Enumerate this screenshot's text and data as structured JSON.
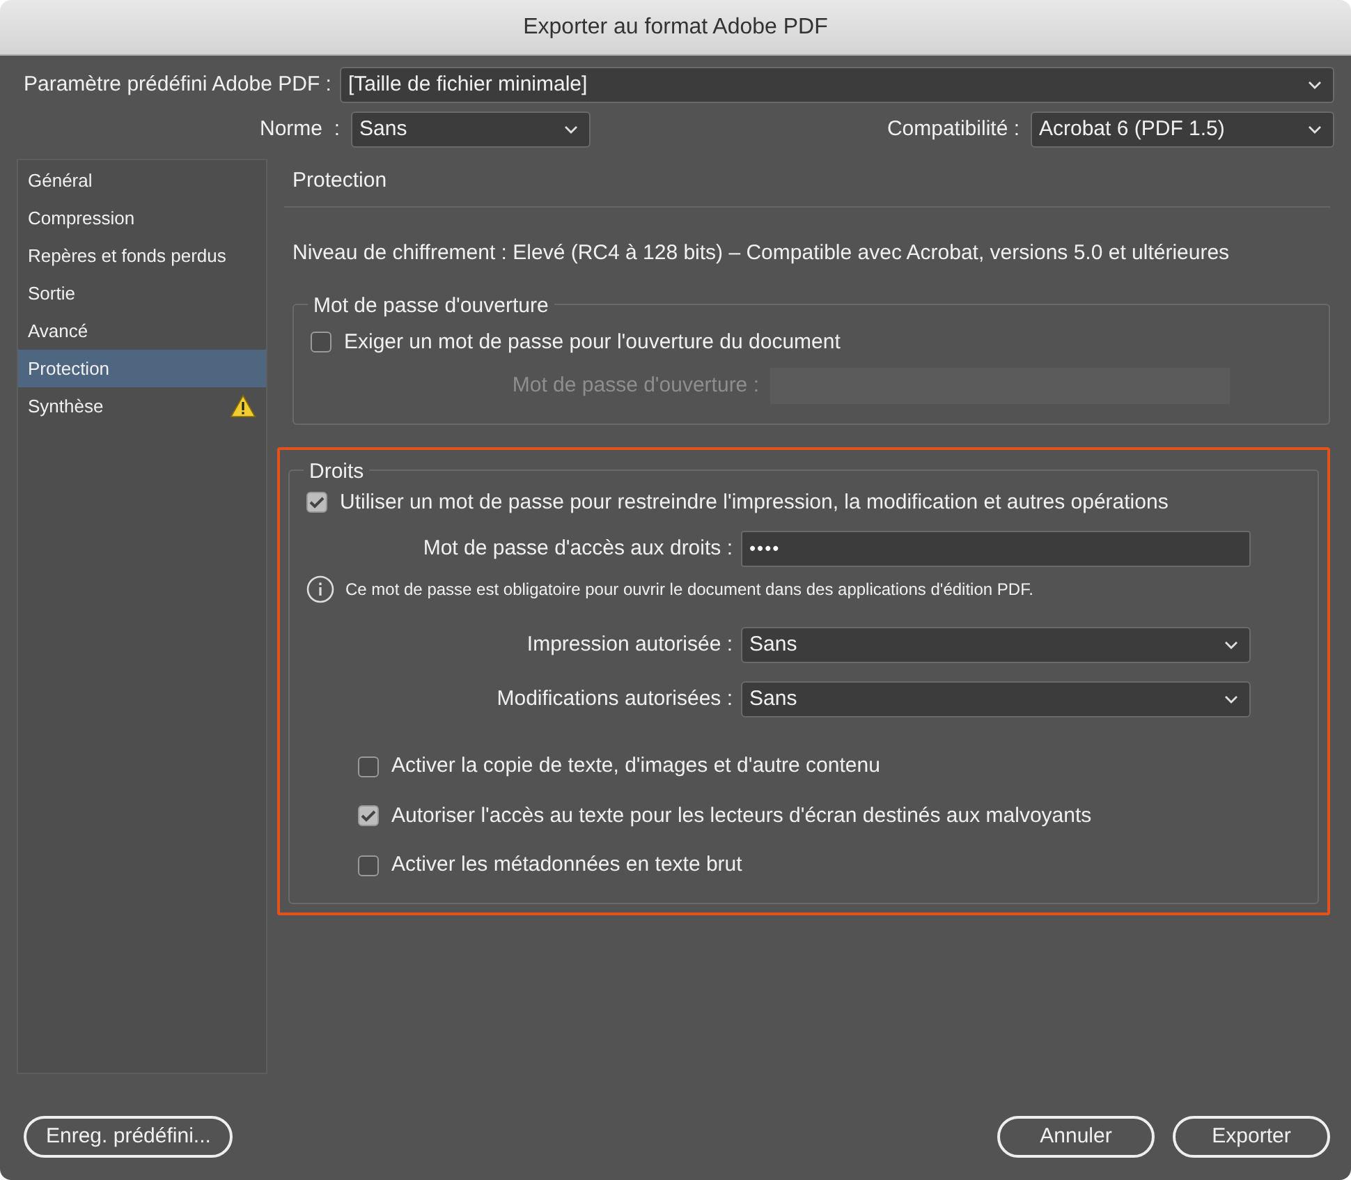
{
  "window": {
    "title": "Exporter au format Adobe PDF"
  },
  "preset": {
    "label": "Paramètre prédéfini Adobe PDF :",
    "value": "[Taille de fichier minimale]"
  },
  "standard": {
    "label": "Norme  :",
    "value": "Sans"
  },
  "compatibility": {
    "label": "Compatibilité :",
    "value": "Acrobat 6 (PDF 1.5)"
  },
  "sidebar": {
    "items": [
      {
        "label": "Général",
        "selected": false,
        "warning": false
      },
      {
        "label": "Compression",
        "selected": false,
        "warning": false
      },
      {
        "label": "Repères et fonds perdus",
        "selected": false,
        "warning": false
      },
      {
        "label": "Sortie",
        "selected": false,
        "warning": false
      },
      {
        "label": "Avancé",
        "selected": false,
        "warning": false
      },
      {
        "label": "Protection",
        "selected": true,
        "warning": false
      },
      {
        "label": "Synthèse",
        "selected": false,
        "warning": true
      }
    ]
  },
  "panel": {
    "title": "Protection",
    "encryption": "Niveau de chiffrement : Elevé (RC4 à 128 bits) – Compatible avec Acrobat, versions 5.0 et ultérieures"
  },
  "open_password": {
    "title": "Mot de passe d'ouverture",
    "checkbox": {
      "label": "Exiger un mot de passe pour l'ouverture du document",
      "checked": false
    },
    "field": {
      "label": "Mot de passe d'ouverture :",
      "disabled": true
    }
  },
  "permissions": {
    "title": "Droits",
    "highlighted": true,
    "checkbox": {
      "label": "Utiliser un mot de passe pour restreindre l'impression, la modification et autres opérations",
      "checked": true
    },
    "password": {
      "label": "Mot de passe d'accès aux droits :",
      "value": "••••"
    },
    "info": "Ce mot de passe est obligatoire pour ouvrir le document dans des applications d'édition PDF.",
    "printing": {
      "label": "Impression autorisée :",
      "value": "Sans"
    },
    "changes": {
      "label": "Modifications autorisées :",
      "value": "Sans"
    },
    "options": [
      {
        "label": "Activer la copie de texte, d'images et d'autre contenu",
        "checked": false
      },
      {
        "label": "Autoriser l'accès au texte pour les lecteurs d'écran destinés aux malvoyants",
        "checked": true
      },
      {
        "label": "Activer les métadonnées en texte brut",
        "checked": false
      }
    ]
  },
  "buttons": {
    "save_preset": "Enreg. prédéfini...",
    "cancel": "Annuler",
    "export": "Exporter"
  }
}
